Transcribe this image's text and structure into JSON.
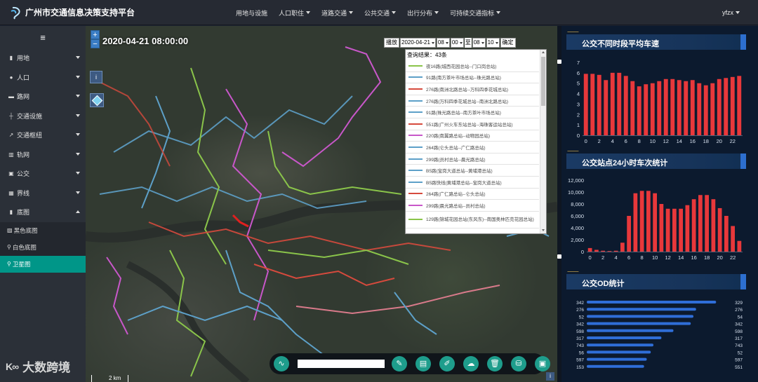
{
  "header": {
    "title": "广州市交通信息决策支持平台",
    "nav": [
      {
        "label": "用地与设施",
        "dropdown": false
      },
      {
        "label": "人口职住",
        "dropdown": true
      },
      {
        "label": "道路交通",
        "dropdown": true
      },
      {
        "label": "公共交通",
        "dropdown": true
      },
      {
        "label": "出行分布",
        "dropdown": true
      },
      {
        "label": "可持续交通指标",
        "dropdown": true
      }
    ],
    "user": "yfzx"
  },
  "sidebar": {
    "menu_icon": "≡",
    "items": [
      {
        "label": "用地",
        "icon": "bar-chart-icon"
      },
      {
        "label": "人口",
        "icon": "user-icon"
      },
      {
        "label": "路网",
        "icon": "car-icon"
      },
      {
        "label": "交通设施",
        "icon": "signpost-icon"
      },
      {
        "label": "交通枢纽",
        "icon": "route-icon"
      },
      {
        "label": "轨网",
        "icon": "train-icon"
      },
      {
        "label": "公交",
        "icon": "bus-icon"
      },
      {
        "label": "界线",
        "icon": "boundary-icon"
      },
      {
        "label": "底图",
        "icon": "map-icon",
        "expanded": true
      }
    ],
    "subitems": [
      {
        "label": "黑色底图",
        "active": false
      },
      {
        "label": "白色底图",
        "active": false
      },
      {
        "label": "卫星图",
        "active": true
      }
    ]
  },
  "map": {
    "datetime": "2020-04-21 08:00:00",
    "zoom_in": "+",
    "zoom_out": "−",
    "info": "i",
    "scale": "2 km",
    "watermark": "大数跨境",
    "watermark_mark": "K∞"
  },
  "query": {
    "play_label": "播放",
    "date": "2020-04-21",
    "hour_from": "08",
    "min_from": "00",
    "to_label": "至",
    "hour_to": "08",
    "min_to": "10",
    "confirm_label": "确定",
    "result_count": "查询结果：43条",
    "routes": [
      {
        "name": "夜16路(城西花园总站--门口岗总站)",
        "color": "#8ac44a"
      },
      {
        "name": "91路(南方茶叶市场总站--珠光路总站)",
        "color": "#5da0c8"
      },
      {
        "name": "276路(南洲北路总站--万科四季花城总站)",
        "color": "#d64a3d"
      },
      {
        "name": "276路(万科四季花城总站--南洲北路总站)",
        "color": "#5da0c8"
      },
      {
        "name": "91路(珠光路总站--南方茶叶市场总站)",
        "color": "#5da0c8"
      },
      {
        "name": "551路(广州火车东站总站--海珠客运站总站)",
        "color": "#d64a3d"
      },
      {
        "name": "220路(南翼路总站--动物园总站)",
        "color": "#c857c9"
      },
      {
        "name": "264路(仑头总站--广仁路总站)",
        "color": "#5da0c8"
      },
      {
        "name": "299路(员村总站--晨光路总站)",
        "color": "#5da0c8"
      },
      {
        "name": "B5路(宝岗大道总站--黄埔港总站)",
        "color": "#5da0c8"
      },
      {
        "name": "B5路快线(黄埔港总站--宝岗大道总站)",
        "color": "#5da0c8"
      },
      {
        "name": "264路(广仁路总站--仑头总站)",
        "color": "#d64a3d"
      },
      {
        "name": "299路(晨光路总站--员村总站)",
        "color": "#c857c9"
      },
      {
        "name": "129路(锦城花园总站(东风东)--南国奥林匹克花园总站)",
        "color": "#8ac44a"
      }
    ]
  },
  "toolbar": {
    "buttons": [
      {
        "name": "pulse-icon",
        "glyph": "∿"
      },
      {
        "name": "pencil-icon",
        "glyph": "✎"
      },
      {
        "name": "clipboard-icon",
        "glyph": "▤"
      },
      {
        "name": "edit-icon",
        "glyph": "✐"
      },
      {
        "name": "cloud-upload-icon",
        "glyph": "☁"
      },
      {
        "name": "trash-icon",
        "glyph": "🗑"
      },
      {
        "name": "stamp-icon",
        "glyph": "⛁"
      },
      {
        "name": "image-icon",
        "glyph": "▣"
      }
    ]
  },
  "panels": {
    "speed_title": "公交不同时段平均车速",
    "trips_title": "公交站点24小时车次统计",
    "od_title": "公交OD统计"
  },
  "chart_data": [
    {
      "type": "bar",
      "title": "公交不同时段平均车速",
      "x": [
        0,
        1,
        2,
        3,
        4,
        5,
        6,
        7,
        8,
        9,
        10,
        11,
        12,
        13,
        14,
        15,
        16,
        17,
        18,
        19,
        20,
        21,
        22,
        23
      ],
      "xticks": [
        "0",
        "2",
        "4",
        "6",
        "8",
        "10",
        "12",
        "14",
        "16",
        "18",
        "20",
        "22"
      ],
      "values": [
        5.9,
        5.9,
        5.8,
        5.3,
        6.0,
        6.0,
        5.7,
        5.2,
        4.7,
        4.9,
        5.0,
        5.2,
        5.4,
        5.4,
        5.3,
        5.2,
        5.3,
        5.0,
        4.8,
        5.0,
        5.4,
        5.5,
        5.6,
        5.7
      ],
      "ylim": [
        0,
        7
      ],
      "yticks": [
        "0",
        "1",
        "2",
        "3",
        "4",
        "5",
        "6",
        "7"
      ],
      "color": "#e8383b"
    },
    {
      "type": "bar",
      "title": "公交站点24小时车次统计",
      "x": [
        0,
        1,
        2,
        3,
        4,
        5,
        6,
        7,
        8,
        9,
        10,
        11,
        12,
        13,
        14,
        15,
        16,
        17,
        18,
        19,
        20,
        21,
        22,
        23
      ],
      "xticks": [
        "0",
        "2",
        "4",
        "6",
        "8",
        "10",
        "12",
        "14",
        "16",
        "18",
        "20",
        "22"
      ],
      "values": [
        600,
        300,
        150,
        100,
        150,
        1500,
        6000,
        9800,
        10200,
        10200,
        9800,
        8000,
        7200,
        7200,
        7200,
        7800,
        8800,
        9500,
        9500,
        8800,
        7300,
        6000,
        4300,
        1800
      ],
      "ylim": [
        0,
        12000
      ],
      "yticks": [
        "0",
        "2,000",
        "4,000",
        "6,000",
        "8,000",
        "10,000",
        "12,000"
      ],
      "color": "#e8383b"
    },
    {
      "type": "bar",
      "orientation": "horizontal",
      "title": "公交OD统计",
      "left_labels": [
        "342",
        "276",
        "52",
        "342",
        "598",
        "317",
        "743",
        "56",
        "597",
        "153"
      ],
      "right_labels": [
        "329",
        "276",
        "54",
        "342",
        "598",
        "317",
        "743",
        "52",
        "597",
        "551"
      ],
      "values": [
        0.97,
        0.82,
        0.8,
        0.78,
        0.65,
        0.56,
        0.5,
        0.48,
        0.45,
        0.43
      ],
      "color": "#2f6ed8"
    }
  ]
}
